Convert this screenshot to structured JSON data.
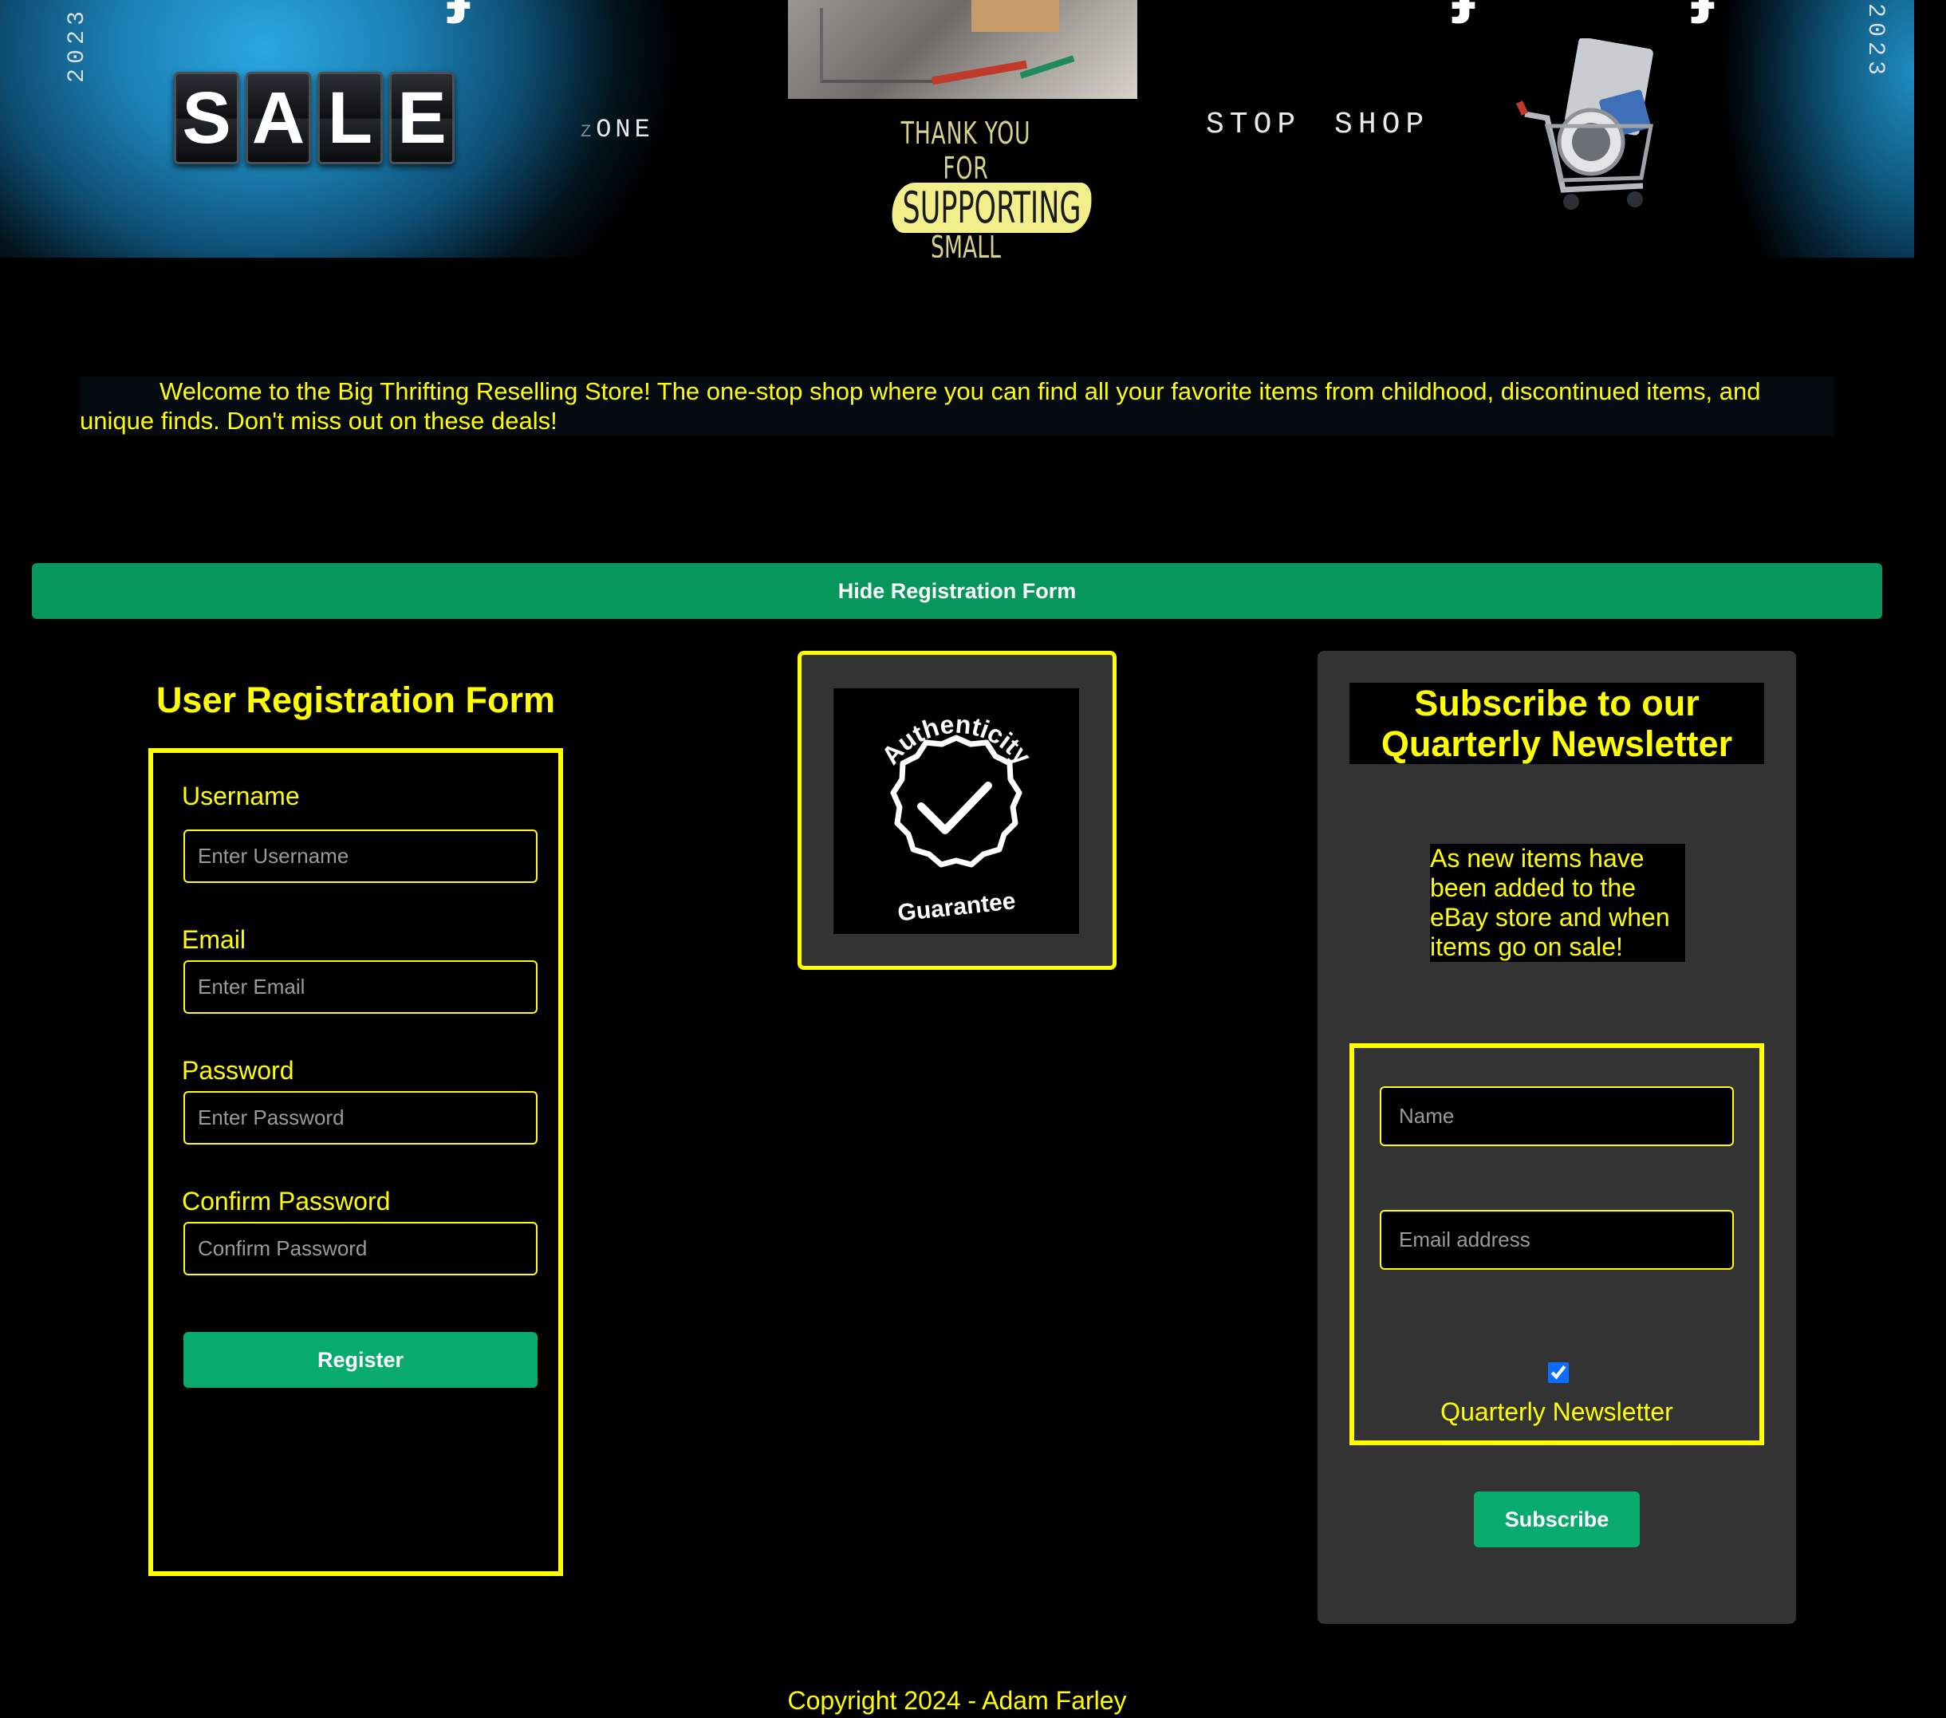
{
  "banner": {
    "year": "2023",
    "sale_letters": [
      "S",
      "A",
      "L",
      "E"
    ],
    "zone_prefix": "Z",
    "zone_text": "ONE",
    "thanks_line1": "THANK YOU FOR",
    "thanks_line2": "SUPPORTING",
    "thanks_line3": "SMALL BUSINESS",
    "stop_shop": "STOP  SHOP"
  },
  "welcome": {
    "text": "Welcome to the Big Thrifting Reselling Store! The one-stop shop where you can find all your favorite items from childhood, discontinued items, and unique finds. Don't miss out on these deals!"
  },
  "toggle": {
    "label": "Hide Registration Form"
  },
  "registration": {
    "title": "User Registration Form",
    "fields": [
      {
        "label": "Username",
        "placeholder": "Enter Username",
        "value": ""
      },
      {
        "label": "Email",
        "placeholder": "Enter Email",
        "value": ""
      },
      {
        "label": "Password",
        "placeholder": "Enter Password",
        "value": ""
      },
      {
        "label": "Confirm Password",
        "placeholder": "Confirm Password",
        "value": ""
      }
    ],
    "submit_label": "Register"
  },
  "badge": {
    "top_text": "Authenticity",
    "bottom_text": "Guarantee"
  },
  "newsletter": {
    "title": "Subscribe to our Quarterly Newsletter",
    "description": "As new items have been added to the eBay store and when items go on sale!",
    "name_placeholder": "Name",
    "email_placeholder": "Email address",
    "checkbox_label": "Quarterly Newsletter",
    "checkbox_checked": true,
    "submit_label": "Subscribe"
  },
  "colors": {
    "accent": "#ffff00",
    "button_green": "#08aa6e",
    "toggle_green": "#07965b",
    "panel_gray": "#333333",
    "background": "#000000"
  },
  "footer": {
    "copyright": "Copyright 2024 - Adam Farley"
  }
}
